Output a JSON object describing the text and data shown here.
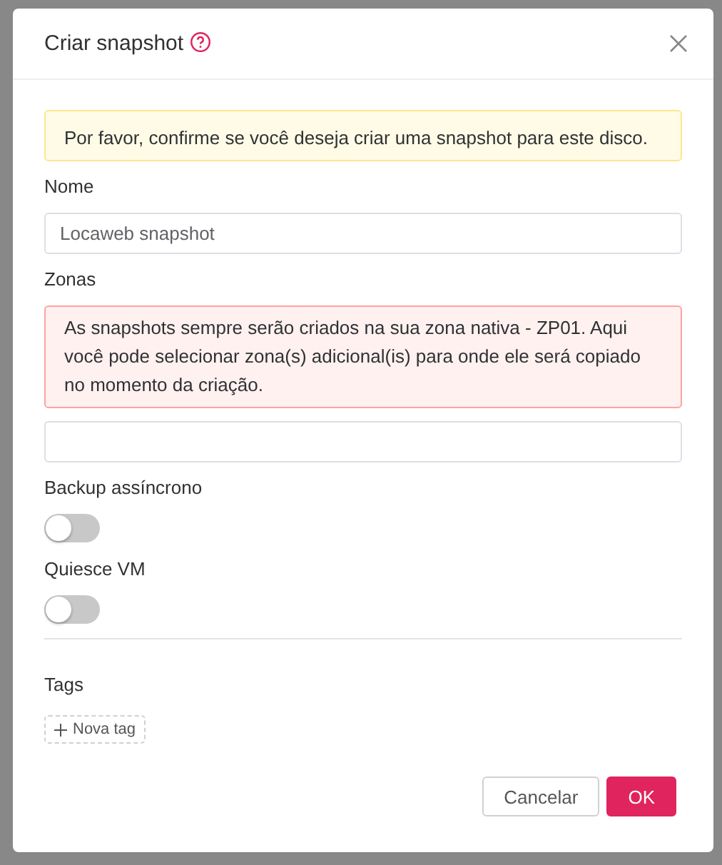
{
  "dialog": {
    "title": "Criar snapshot",
    "notice": "Por favor, confirme se você deseja criar uma snapshot para este disco.",
    "fields": [
      {
        "kind": "input",
        "label": "Nome",
        "value": "Locaweb snapshot"
      },
      {
        "kind": "select",
        "label": "Zonas",
        "warning": "As snapshots sempre serão criados na sua zona nativa - ZP01. Aqui você pode selecionar zona(s) adicional(is) para onde ele será copiado no momento da criação."
      },
      {
        "kind": "switch",
        "label": "Backup assíncrono",
        "on": false
      },
      {
        "kind": "switch",
        "label": "Quiesce VM",
        "on": false
      }
    ],
    "tags": {
      "label": "Tags",
      "add_button": "Nova tag"
    },
    "buttons": [
      {
        "label": "Cancelar",
        "kind": "default"
      },
      {
        "label": "OK",
        "kind": "primary"
      }
    ]
  }
}
